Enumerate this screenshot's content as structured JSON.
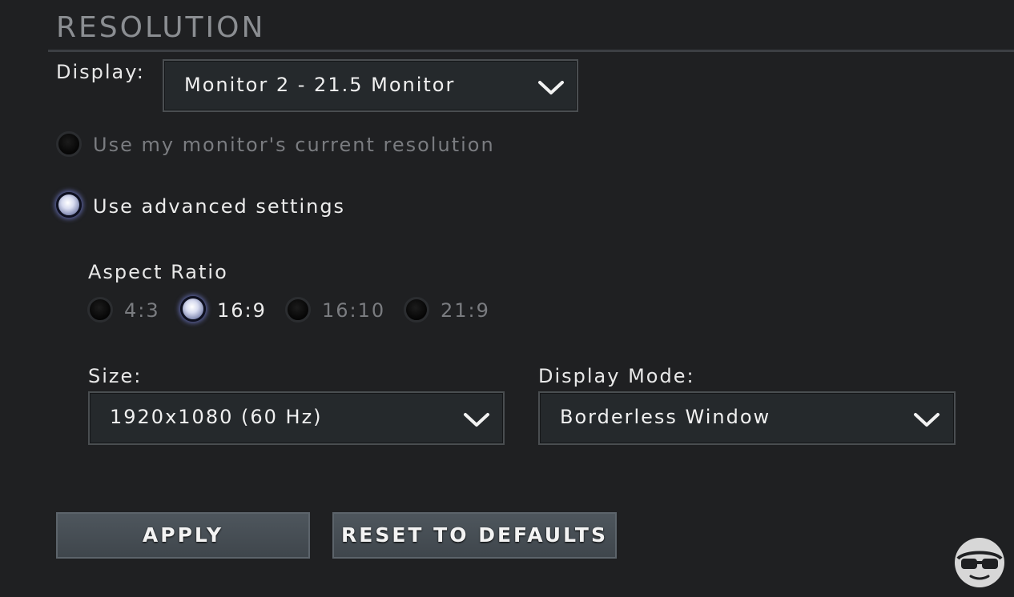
{
  "section": {
    "title": "RESOLUTION"
  },
  "display": {
    "label": "Display:",
    "selected": "Monitor 2 - 21.5 Monitor"
  },
  "resolution_mode": {
    "options": [
      {
        "label": "Use my monitor's current resolution",
        "selected": false
      },
      {
        "label": "Use advanced settings",
        "selected": true
      }
    ]
  },
  "aspect_ratio": {
    "label": "Aspect Ratio",
    "options": [
      {
        "label": "4:3",
        "selected": false
      },
      {
        "label": "16:9",
        "selected": true
      },
      {
        "label": "16:10",
        "selected": false
      },
      {
        "label": "21:9",
        "selected": false
      }
    ]
  },
  "size": {
    "label": "Size:",
    "selected": "1920x1080 (60 Hz)"
  },
  "display_mode": {
    "label": "Display Mode:",
    "selected": "Borderless Window"
  },
  "buttons": {
    "apply": "APPLY",
    "reset": "RESET TO DEFAULTS"
  },
  "icons": {
    "dropdown": "chevron-down-icon",
    "watermark": "glasses-face-logo"
  },
  "colors": {
    "background": "#1f2022",
    "radio_selected_glow": "#7882dc",
    "button": "#474f55"
  }
}
